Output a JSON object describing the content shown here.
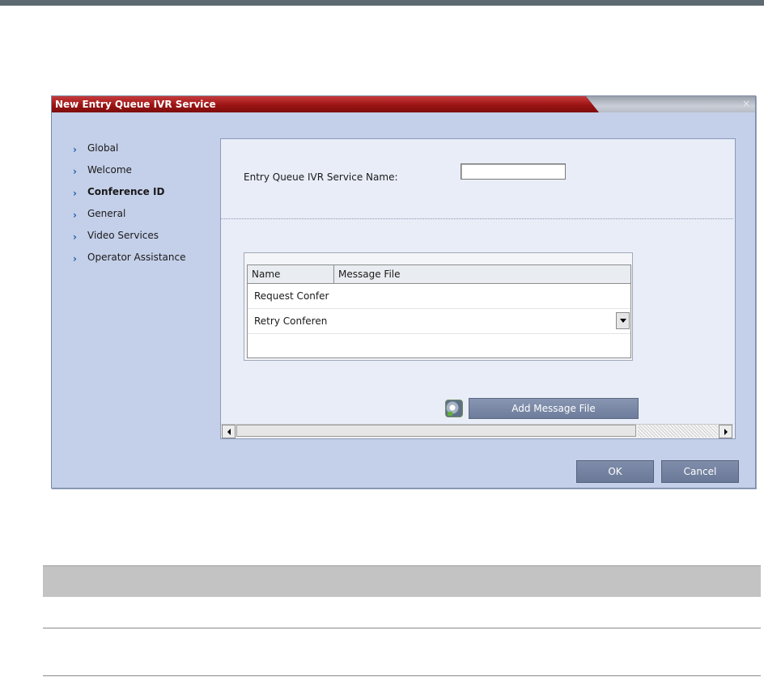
{
  "dialog": {
    "title": "New Entry Queue IVR Service",
    "close_glyph": "×"
  },
  "nav": {
    "items": [
      {
        "label": "Global",
        "active": false
      },
      {
        "label": "Welcome",
        "active": false
      },
      {
        "label": "Conference ID",
        "active": true
      },
      {
        "label": "General",
        "active": false
      },
      {
        "label": "Video Services",
        "active": false
      },
      {
        "label": "Operator Assistance",
        "active": false
      }
    ]
  },
  "form": {
    "service_name_label": "Entry Queue IVR Service Name:",
    "service_name_value": ""
  },
  "table": {
    "columns": [
      "Name",
      "Message File"
    ],
    "rows": [
      {
        "name": "Request Confer",
        "message_file": ""
      },
      {
        "name": "Retry Conferen",
        "message_file": ""
      }
    ]
  },
  "actions": {
    "add_message_file": "Add Message File",
    "ok": "OK",
    "cancel": "Cancel"
  },
  "icons": {
    "chevron": "chevron-right-icon",
    "speaker": "speaker-icon",
    "dropdown": "chevron-down-icon"
  },
  "colors": {
    "title_red": "#9c1414",
    "dialog_bg": "#c4cfe9",
    "panel_bg": "#e8edf8",
    "button_bg": "#6a7997",
    "nav_chevron": "#1f5fa8"
  }
}
